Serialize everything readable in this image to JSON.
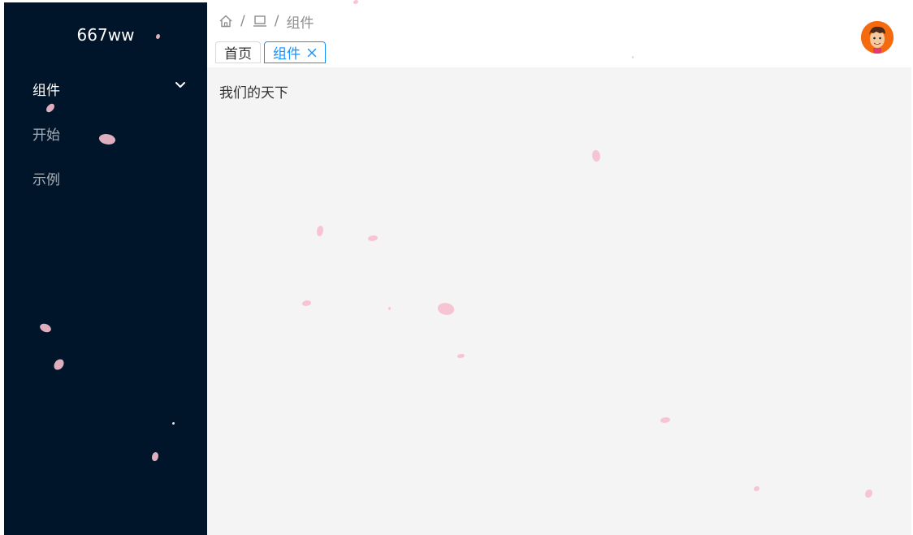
{
  "sidebar": {
    "logo": "667ww",
    "group": {
      "label": "组件",
      "expanded": true
    },
    "items": [
      {
        "label": "开始"
      },
      {
        "label": "示例"
      }
    ],
    "background": "#001529"
  },
  "header": {
    "breadcrumb": {
      "icons": [
        "home-icon",
        "laptop-icon"
      ],
      "current": "组件",
      "separator": "/"
    },
    "tabs": [
      {
        "label": "首页",
        "active": false
      },
      {
        "label": "组件",
        "active": true,
        "closable": true
      }
    ],
    "avatar": "avatar-cartoon-face"
  },
  "content": {
    "text": "我们的天下",
    "background": "#f4f4f4"
  },
  "colors": {
    "accent": "#1890ff",
    "petal": "#f6bfcf",
    "avatar_bg": "#f46a0e"
  }
}
